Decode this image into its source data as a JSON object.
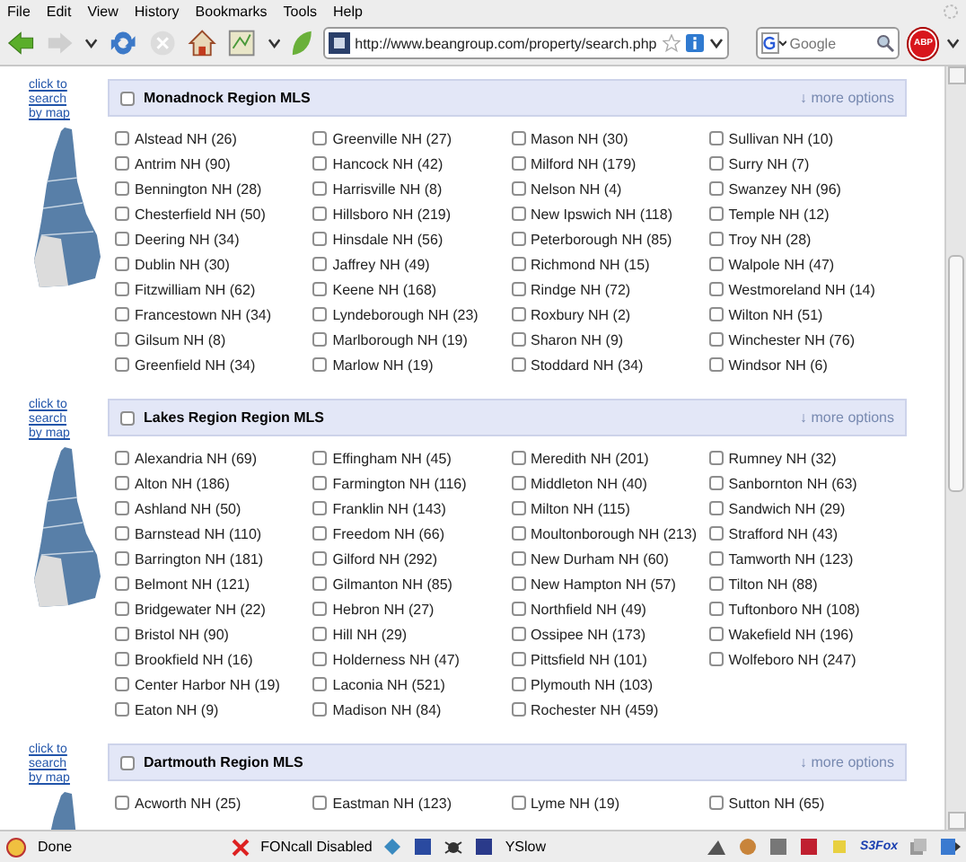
{
  "menu": [
    {
      "label": "File"
    },
    {
      "label": "Edit"
    },
    {
      "label": "View"
    },
    {
      "label": "History"
    },
    {
      "label": "Bookmarks"
    },
    {
      "label": "Tools"
    },
    {
      "label": "Help"
    }
  ],
  "toolbar": {
    "url": "http://www.beangroup.com/property/search.php",
    "search_placeholder": "Google",
    "adblock_badge": "ABP"
  },
  "regions": [
    {
      "title": "Monadnock Region MLS",
      "checked": false,
      "more_link": "↓ more options",
      "map_link": "click to search by map",
      "columns": [
        [
          {
            "label": "Alstead NH (26)",
            "checked": false
          },
          {
            "label": "Antrim NH (90)",
            "checked": false
          },
          {
            "label": "Bennington NH (28)",
            "checked": false
          },
          {
            "label": "Chesterfield NH (50)",
            "checked": false
          },
          {
            "label": "Deering NH (34)",
            "checked": false
          },
          {
            "label": "Dublin NH (30)",
            "checked": false
          },
          {
            "label": "Fitzwilliam NH (62)",
            "checked": false
          },
          {
            "label": "Francestown NH (34)",
            "checked": false
          },
          {
            "label": "Gilsum NH (8)",
            "checked": false
          },
          {
            "label": "Greenfield NH (34)",
            "checked": false
          }
        ],
        [
          {
            "label": "Greenville NH (27)",
            "checked": false
          },
          {
            "label": "Hancock NH (42)",
            "checked": false
          },
          {
            "label": "Harrisville NH (8)",
            "checked": false
          },
          {
            "label": "Hillsboro NH (219)",
            "checked": false
          },
          {
            "label": "Hinsdale NH (56)",
            "checked": false
          },
          {
            "label": "Jaffrey NH (49)",
            "checked": false
          },
          {
            "label": "Keene NH (168)",
            "checked": false
          },
          {
            "label": "Lyndeborough NH (23)",
            "checked": false
          },
          {
            "label": "Marlborough NH (19)",
            "checked": false
          },
          {
            "label": "Marlow NH (19)",
            "checked": false
          }
        ],
        [
          {
            "label": "Mason NH (30)",
            "checked": false
          },
          {
            "label": "Milford NH (179)",
            "checked": false
          },
          {
            "label": "Nelson NH (4)",
            "checked": false
          },
          {
            "label": "New Ipswich NH (118)",
            "checked": false
          },
          {
            "label": "Peterborough NH (85)",
            "checked": false
          },
          {
            "label": "Richmond NH (15)",
            "checked": false
          },
          {
            "label": "Rindge NH (72)",
            "checked": false
          },
          {
            "label": "Roxbury NH (2)",
            "checked": false
          },
          {
            "label": "Sharon NH (9)",
            "checked": false
          },
          {
            "label": "Stoddard NH (34)",
            "checked": false
          }
        ],
        [
          {
            "label": "Sullivan NH (10)",
            "checked": false
          },
          {
            "label": "Surry NH (7)",
            "checked": false
          },
          {
            "label": "Swanzey NH (96)",
            "checked": false
          },
          {
            "label": "Temple NH (12)",
            "checked": false
          },
          {
            "label": "Troy NH (28)",
            "checked": false
          },
          {
            "label": "Walpole NH (47)",
            "checked": false
          },
          {
            "label": "Westmoreland NH (14)",
            "checked": false
          },
          {
            "label": "Wilton NH (51)",
            "checked": false
          },
          {
            "label": "Winchester NH (76)",
            "checked": false
          },
          {
            "label": "Windsor NH (6)",
            "checked": false
          }
        ]
      ]
    },
    {
      "title": "Lakes Region Region MLS",
      "checked": false,
      "more_link": "↓ more options",
      "map_link": "click to search by map",
      "columns": [
        [
          {
            "label": "Alexandria NH (69)",
            "checked": false
          },
          {
            "label": "Alton NH (186)",
            "checked": false
          },
          {
            "label": "Ashland NH (50)",
            "checked": false
          },
          {
            "label": "Barnstead NH (110)",
            "checked": false
          },
          {
            "label": "Barrington NH (181)",
            "checked": false
          },
          {
            "label": "Belmont NH (121)",
            "checked": false
          },
          {
            "label": "Bridgewater NH (22)",
            "checked": false
          },
          {
            "label": "Bristol NH (90)",
            "checked": false
          },
          {
            "label": "Brookfield NH (16)",
            "checked": false
          },
          {
            "label": "Center Harbor NH (19)",
            "checked": false
          },
          {
            "label": "Eaton NH (9)",
            "checked": false
          }
        ],
        [
          {
            "label": "Effingham NH (45)",
            "checked": false
          },
          {
            "label": "Farmington NH (116)",
            "checked": false
          },
          {
            "label": "Franklin NH (143)",
            "checked": false
          },
          {
            "label": "Freedom NH (66)",
            "checked": false
          },
          {
            "label": "Gilford NH (292)",
            "checked": false
          },
          {
            "label": "Gilmanton NH (85)",
            "checked": false
          },
          {
            "label": "Hebron NH (27)",
            "checked": false
          },
          {
            "label": "Hill NH (29)",
            "checked": false
          },
          {
            "label": "Holderness NH (47)",
            "checked": false
          },
          {
            "label": "Laconia NH (521)",
            "checked": false
          },
          {
            "label": "Madison NH (84)",
            "checked": false
          }
        ],
        [
          {
            "label": "Meredith NH (201)",
            "checked": false
          },
          {
            "label": "Middleton NH (40)",
            "checked": false
          },
          {
            "label": "Milton NH (115)",
            "checked": false
          },
          {
            "label": "Moultonborough NH (213)",
            "checked": false
          },
          {
            "label": "New Durham NH (60)",
            "checked": false
          },
          {
            "label": "New Hampton NH (57)",
            "checked": false
          },
          {
            "label": "Northfield NH (49)",
            "checked": false
          },
          {
            "label": "Ossipee NH (173)",
            "checked": false
          },
          {
            "label": "Pittsfield NH (101)",
            "checked": false
          },
          {
            "label": "Plymouth NH (103)",
            "checked": false
          },
          {
            "label": "Rochester NH (459)",
            "checked": false
          }
        ],
        [
          {
            "label": "Rumney NH (32)",
            "checked": false
          },
          {
            "label": "Sanbornton NH (63)",
            "checked": false
          },
          {
            "label": "Sandwich NH (29)",
            "checked": false
          },
          {
            "label": "Strafford NH (43)",
            "checked": false
          },
          {
            "label": "Tamworth NH (123)",
            "checked": false
          },
          {
            "label": "Tilton NH (88)",
            "checked": false
          },
          {
            "label": "Tuftonboro NH (108)",
            "checked": false
          },
          {
            "label": "Wakefield NH (196)",
            "checked": false
          },
          {
            "label": "Wolfeboro NH (247)",
            "checked": false
          }
        ]
      ]
    },
    {
      "title": "Dartmouth Region MLS",
      "checked": false,
      "more_link": "↓ more options",
      "map_link": "click to search by map",
      "columns": [
        [
          {
            "label": "Acworth NH (25)",
            "checked": false
          }
        ],
        [
          {
            "label": "Eastman NH (123)",
            "checked": false
          }
        ],
        [
          {
            "label": "Lyme NH (19)",
            "checked": false
          }
        ],
        [
          {
            "label": "Sutton NH (65)",
            "checked": false
          }
        ]
      ]
    }
  ],
  "status_bar": {
    "text": "Done",
    "fon_label": "FONcall Disabled",
    "yslow_label": "YSlow",
    "s3fox_label": "S3Fox"
  }
}
